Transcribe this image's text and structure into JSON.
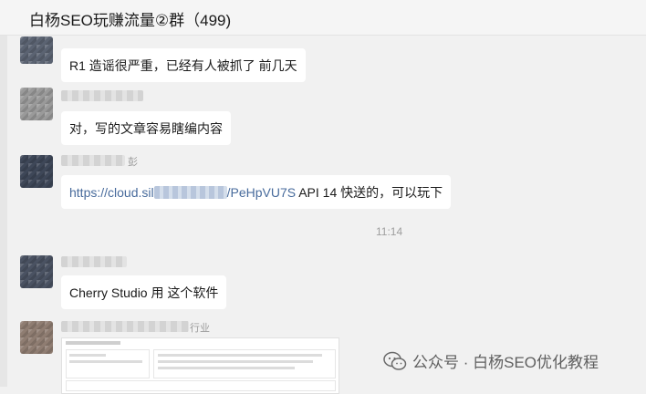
{
  "header": {
    "title": "白杨SEO玩赚流量②群（499)"
  },
  "messages": [
    {
      "text": "R1 造谣很严重，已经有人被抓了  前几天"
    },
    {
      "text": "对，写的文章容易瞎编内容"
    },
    {
      "link_start": "https://cloud.sil",
      "link_end": "/PeHpVU7S",
      "suffix": " API 14 快送的，可以玩下",
      "name_tail": "彭"
    },
    {
      "text": "Cherry Studio  用 这个软件"
    },
    {
      "name_tail": "行业"
    }
  ],
  "timestamp": "11:14",
  "watermark": {
    "text": "公众号 · 白杨SEO优化教程",
    "icon": "wechat-icon"
  }
}
